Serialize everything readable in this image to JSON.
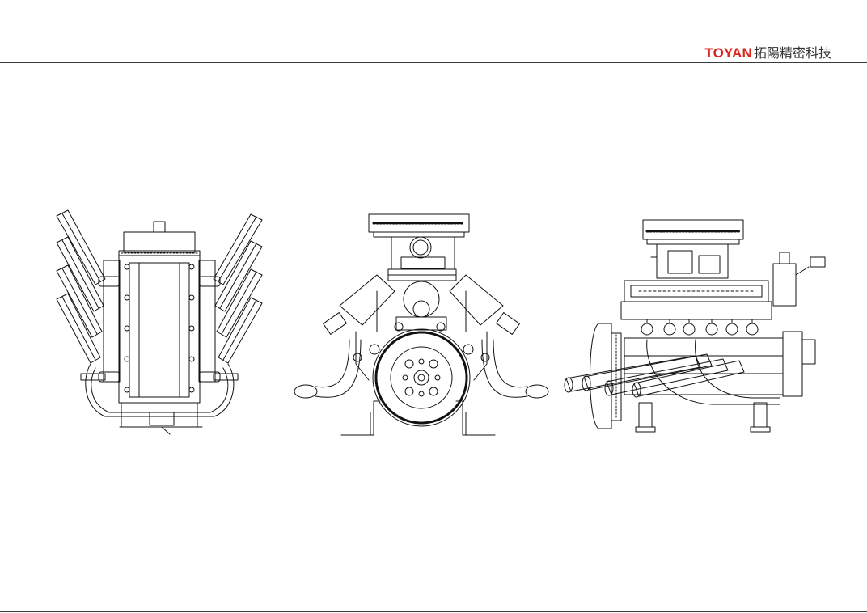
{
  "header": {
    "brand_en": "TOYAN",
    "brand_cn": "拓陽精密科技",
    "brand_color": "#d7261e"
  },
  "drawing": {
    "views": [
      {
        "icon": "engine-top-view"
      },
      {
        "icon": "engine-front-view"
      },
      {
        "icon": "engine-side-view"
      }
    ],
    "line_color": "#111111"
  }
}
